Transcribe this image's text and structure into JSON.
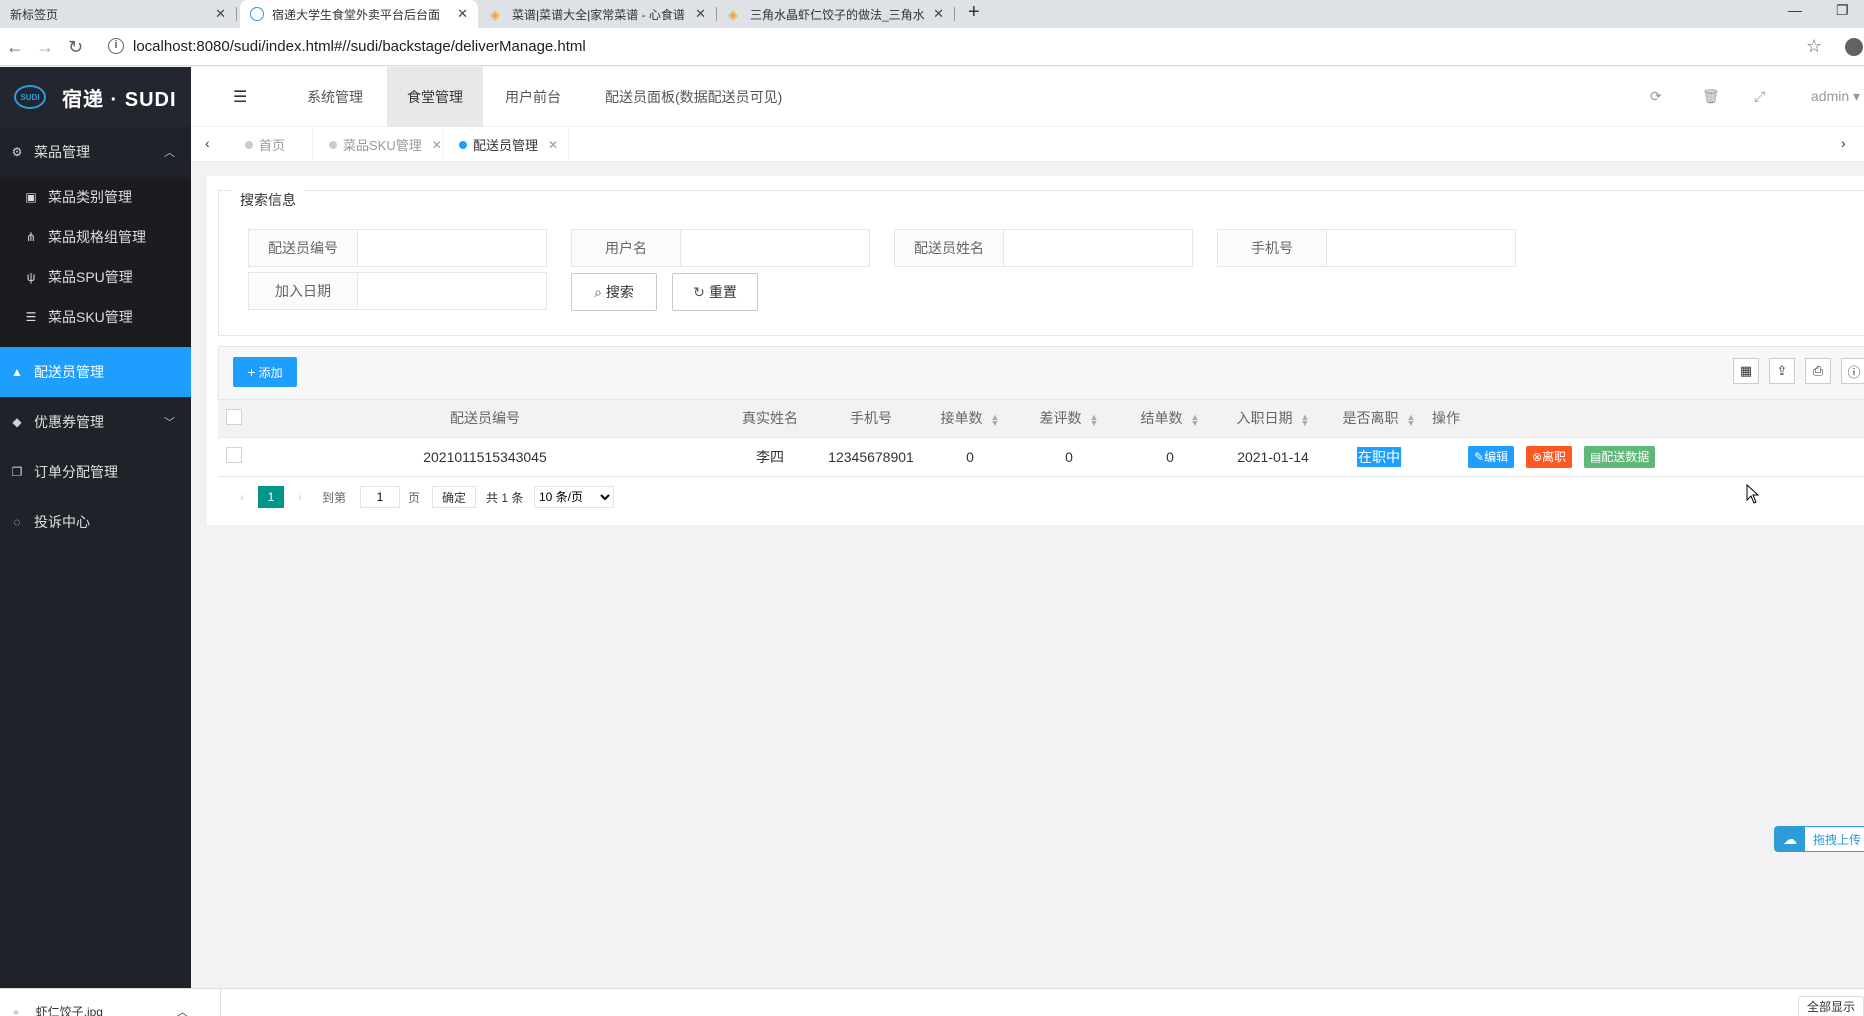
{
  "browser": {
    "tabs": [
      {
        "title": "新标签页"
      },
      {
        "title": "宿递大学生食堂外卖平台后台面"
      },
      {
        "title": "菜谱|菜谱大全|家常菜谱 - 心食谱"
      },
      {
        "title": "三角水晶虾仁饺子的做法_三角水"
      }
    ],
    "url": "localhost:8080/sudi/index.html#//sudi/backstage/deliverManage.html"
  },
  "sidebar": {
    "logo_mark": "SUDI",
    "logo_text": "宿递 · SUDI",
    "groups": [
      {
        "label": "菜品管理",
        "icon": "gears-icon"
      },
      {
        "label": "配送员管理",
        "icon": "shopping-bag-icon"
      },
      {
        "label": "优惠券管理",
        "icon": "tag-icon"
      },
      {
        "label": "订单分配管理",
        "icon": "clipboard-icon"
      },
      {
        "label": "投诉中心",
        "icon": "chat-icon"
      }
    ],
    "submenu": [
      {
        "label": "菜品类别管理",
        "icon": "inbox-icon"
      },
      {
        "label": "菜品规格组管理",
        "icon": "sitemap-icon"
      },
      {
        "label": "菜品SPU管理",
        "icon": "cutlery-icon"
      },
      {
        "label": "菜品SKU管理",
        "icon": "list-icon"
      }
    ]
  },
  "header": {
    "nav": [
      "系统管理",
      "食堂管理",
      "用户前台",
      "配送员面板(数据配送员可见)"
    ],
    "user": "admin"
  },
  "page_tabs": [
    {
      "label": "首页"
    },
    {
      "label": "菜品SKU管理"
    },
    {
      "label": "配送员管理"
    }
  ],
  "search": {
    "legend": "搜索信息",
    "fields": [
      "配送员编号",
      "用户名",
      "配送员姓名",
      "手机号",
      "加入日期"
    ],
    "search_label": "搜索",
    "reset_label": "重置"
  },
  "toolbar": {
    "add_label": "添加"
  },
  "table": {
    "columns": [
      "配送员编号",
      "真实姓名",
      "手机号",
      "接单数",
      "差评数",
      "结单数",
      "入职日期",
      "是否离职",
      "操作"
    ],
    "rows": [
      {
        "id": "2021011515343045",
        "name": "李四",
        "phone": "12345678901",
        "accepted": "0",
        "bad_reviews": "0",
        "completed": "0",
        "join_date": "2021-01-14",
        "status": "在职中"
      }
    ],
    "actions": {
      "edit": "编辑",
      "resign": "离职",
      "data": "配送数据"
    }
  },
  "pager": {
    "current": "1",
    "goto_prefix": "到第",
    "goto_value": "1",
    "goto_suffix": "页",
    "confirm": "确定",
    "total": "共 1 条",
    "page_size": "10 条/页"
  },
  "upload_float": {
    "label": "拖拽上传"
  },
  "downloads": {
    "file": "虾仁饺子.jpg",
    "show_all": "全部显示"
  },
  "colors": {
    "accent": "#1e9fff",
    "sidebar_bg": "#20222a",
    "danger": "#ff5722",
    "success": "#5fb878"
  }
}
